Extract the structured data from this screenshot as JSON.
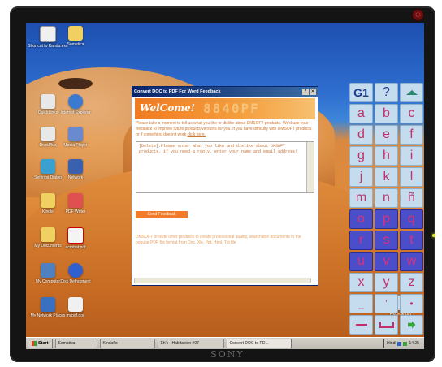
{
  "desktop_icons": [
    {
      "name": "shortcut-kanducate-icon",
      "label": "Shortcut to Kandu.exe",
      "color": "#d02020"
    },
    {
      "name": "somatica-folder-icon",
      "label": "Somatica",
      "color": "#f0d060"
    },
    {
      "name": "quick-icon",
      "label": "QuickLinks",
      "color": "#e0e0e0"
    },
    {
      "name": "internet-explorer-icon",
      "label": "Internet Explorer",
      "color": "#3a7ad0"
    },
    {
      "name": "doc-icon",
      "label": "DocsPlus",
      "color": "#e0e0e0"
    },
    {
      "name": "media-icon",
      "label": "Media Player",
      "color": "#6a8ad0"
    },
    {
      "name": "settings-icon",
      "label": "Settings Dialog",
      "color": "#3aa0d0"
    },
    {
      "name": "network-icon",
      "label": "Network",
      "color": "#3a60b0"
    },
    {
      "name": "folder-icon",
      "label": "Kindle",
      "color": "#f0d060"
    },
    {
      "name": "pdf-writer-icon",
      "label": "PDF Writer",
      "color": "#e05050"
    },
    {
      "name": "my-documents-icon",
      "label": "My Documents",
      "color": "#f0d060"
    },
    {
      "name": "acrobat-icon",
      "label": "acrobat pdf",
      "color": "#e02020"
    },
    {
      "name": "my-computer-icon",
      "label": "My Computer",
      "color": "#5080c0"
    },
    {
      "name": "disk-icon",
      "label": "Disk Defragment",
      "color": "#3060d0"
    },
    {
      "name": "network-places-icon",
      "label": "My Network Places",
      "color": "#3a70c0"
    },
    {
      "name": "pdf-doc-icon",
      "label": "mypdf.doc",
      "color": "#e0e0e0"
    },
    {
      "name": "recycle-bin-icon",
      "label": "Recycle Bin",
      "color": "#c8d8e8"
    }
  ],
  "dialog": {
    "title": "Convert DOC to PDF For Word Feedback",
    "welcome": "WelCome!",
    "welcome_bg": "8840PF",
    "intro": "Please take a moment to tell us what you like or dislike about DMSOFT products. We'd use your feedback to improve future products versions for you. If you have difficulty with DMSOFT products, or if something doesn't work",
    "intro_link": "click here.",
    "feedback_text": "[Delete]:Please enter what you like and dislike about DMSOFT products, if you need a reply, enter your name and email address!",
    "send_button": "Send Feedback",
    "promo": "DMSOFT provide other products to create professional quality, searchable documents in the popular PDF file format from Doc, Xls, Ppt, Html, Txt file"
  },
  "keyboard": {
    "rows": [
      [
        "G1",
        "?",
        "up"
      ],
      [
        "a",
        "b",
        "c"
      ],
      [
        "d",
        "e",
        "f"
      ],
      [
        "g",
        "h",
        "i"
      ],
      [
        "j",
        "k",
        "l"
      ],
      [
        "m",
        "n",
        "ñ"
      ],
      [
        "o",
        "p",
        "q"
      ],
      [
        "r",
        "s",
        "t"
      ],
      [
        "u",
        "v",
        "w"
      ],
      [
        "x",
        "y",
        "z"
      ],
      [
        "_",
        "ʼ",
        "•"
      ],
      [
        "bksp",
        "space",
        "go"
      ]
    ]
  },
  "taskbar": {
    "start": "Start",
    "buttons": [
      "Somatica",
      "Kindaflo",
      "Eh's - Habitacion #07",
      "Convert DOC to PD..."
    ],
    "tray_time": "14:25",
    "tray_text": "Hindi"
  },
  "monitor": {
    "brand": "SONY"
  }
}
